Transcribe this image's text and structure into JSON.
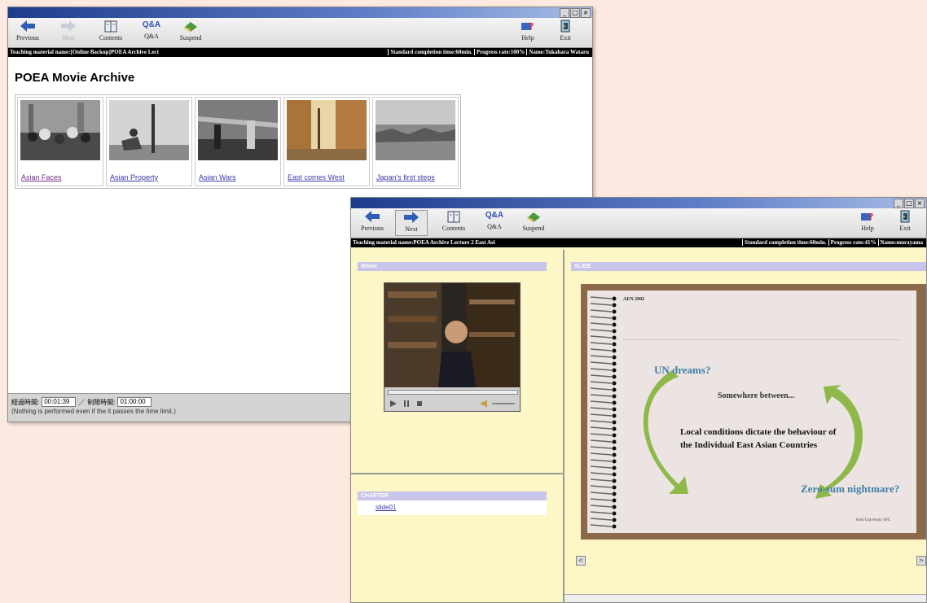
{
  "window1": {
    "controls": [
      "_",
      "□",
      "×"
    ],
    "toolbar": {
      "previous": "Previous",
      "next": "Next",
      "contents": "Contents",
      "qa_glyph": "Q&A",
      "qa_label": "Q&A",
      "suspend": "Suspend",
      "help": "Help",
      "exit": "Exit"
    },
    "info": {
      "material": "Teaching material name:[Online Backup]POEA Archive Lect",
      "standard_time": "Standard completion time:60min.",
      "progress": "Progress rate:100%",
      "name": "Name:Tukahara Wataru"
    },
    "page_title": "POEA Movie Archive",
    "thumbnails": [
      {
        "label": "Asian Faces"
      },
      {
        "label": "Asian Property"
      },
      {
        "label": "Asian Wars"
      },
      {
        "label": "East comes West"
      },
      {
        "label": "Japan's first steps"
      }
    ],
    "bottom": {
      "elapsed_label": "経過時間:",
      "elapsed_value": "00:01:39",
      "separator": "／",
      "limit_label": "制限時間:",
      "limit_value": "01:00:00",
      "note": "(Nothing is performed even if the it passes the time limit.)"
    }
  },
  "window2": {
    "controls": [
      "_",
      "□",
      "×"
    ],
    "toolbar": {
      "previous": "Previous",
      "next": "Next",
      "contents": "Contents",
      "qa_glyph": "Q&A",
      "qa_label": "Q&A",
      "suspend": "Suspend",
      "help": "Help",
      "exit": "Exit"
    },
    "info": {
      "material": "Teaching material name:POEA Archive Lecture 2 East Asi",
      "standard_time": "Standard completion time:60min.",
      "progress": "Progress rate:41%",
      "name": "Name:murayama"
    },
    "movie_header": "Movie",
    "chapter_header": "CHAPTER",
    "chapter_item": "slide01",
    "slide_header": "SLIDE",
    "slide": {
      "code": "AEN 2902",
      "un_dreams": "UN dreams?",
      "between": "Somewhere between...",
      "main_line1": "Local conditions dictate the behaviour of",
      "main_line2": "the Individual East Asian Countries",
      "zero_sum": "Zero-sum nightmare?",
      "footer": "Keio University SFC"
    },
    "nav_prev": "<",
    "nav_next": ">"
  }
}
